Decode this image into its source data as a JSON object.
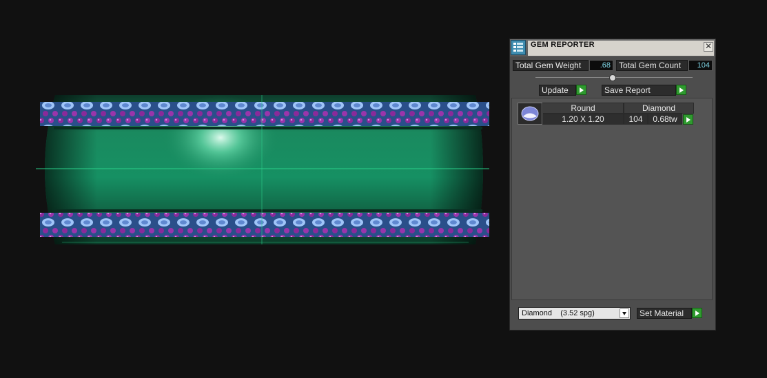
{
  "panel": {
    "title": "GEM REPORTER",
    "close_glyph": "✕",
    "total_gem_weight_label": "Total Gem Weight",
    "total_gem_weight_value": ".68",
    "total_gem_count_label": "Total Gem Count",
    "total_gem_count_value": "104",
    "update_label": "Update",
    "save_report_label": "Save Report",
    "gem_table": {
      "headers": [
        "Round",
        "Diamond"
      ],
      "rows": [
        {
          "size": "1.20 X 1.20",
          "count": "104",
          "weight": "0.68tw"
        }
      ]
    },
    "material_select_value": "Diamond    (3.52 spg)",
    "set_material_label": "Set Material"
  },
  "colors": {
    "background": "#111111",
    "band_green": "#1a8a5f",
    "gem_purple": "#8a2a9a",
    "gem_blue": "#8fb4f0",
    "accent_green": "#2f9a2f",
    "value_text": "#7fd6e6"
  },
  "icons": {
    "app": "gem-reporter-icon",
    "close": "close-icon",
    "gem": "round-gem-icon",
    "arrow": "play-arrow-icon",
    "dropdown": "chevron-down-icon"
  }
}
